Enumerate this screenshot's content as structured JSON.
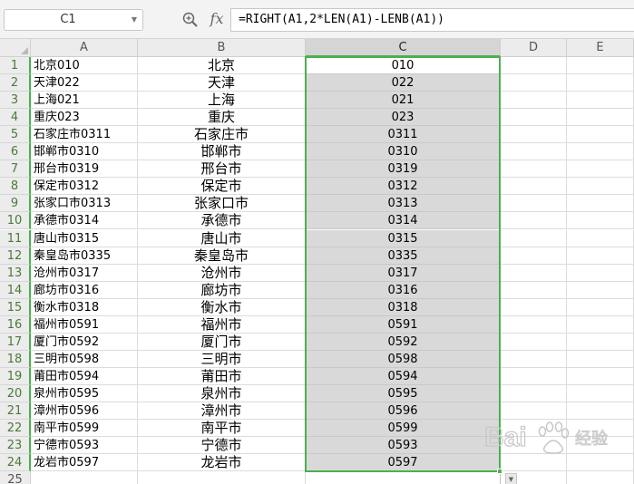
{
  "name_box": {
    "value": "C1"
  },
  "formula_bar": {
    "fx_label": "fx",
    "formula": "=RIGHT(A1,2*LEN(A1)-LENB(A1))"
  },
  "columns": [
    {
      "label": "A",
      "selected": false
    },
    {
      "label": "B",
      "selected": false
    },
    {
      "label": "C",
      "selected": true
    },
    {
      "label": "D",
      "selected": false
    },
    {
      "label": "E",
      "selected": false
    }
  ],
  "rows": [
    {
      "num": "1",
      "a": "北京010",
      "b": "北京",
      "c": "010"
    },
    {
      "num": "2",
      "a": "天津022",
      "b": "天津",
      "c": "022"
    },
    {
      "num": "3",
      "a": "上海021",
      "b": "上海",
      "c": "021"
    },
    {
      "num": "4",
      "a": "重庆023",
      "b": "重庆",
      "c": "023"
    },
    {
      "num": "5",
      "a": "石家庄市0311",
      "b": "石家庄市",
      "c": "0311"
    },
    {
      "num": "6",
      "a": "邯郸市0310",
      "b": "邯郸市",
      "c": "0310"
    },
    {
      "num": "7",
      "a": "邢台市0319",
      "b": "邢台市",
      "c": "0319"
    },
    {
      "num": "8",
      "a": "保定市0312",
      "b": "保定市",
      "c": "0312"
    },
    {
      "num": "9",
      "a": "张家口市0313",
      "b": "张家口市",
      "c": "0313"
    },
    {
      "num": "10",
      "a": "承德市0314",
      "b": "承德市",
      "c": "0314"
    },
    {
      "num": "11",
      "a": "唐山市0315",
      "b": "唐山市",
      "c": "0315"
    },
    {
      "num": "12",
      "a": "秦皇岛市0335",
      "b": "秦皇岛市",
      "c": "0335"
    },
    {
      "num": "13",
      "a": "沧州市0317",
      "b": "沧州市",
      "c": "0317"
    },
    {
      "num": "14",
      "a": "廊坊市0316",
      "b": "廊坊市",
      "c": "0316"
    },
    {
      "num": "15",
      "a": "衡水市0318",
      "b": "衡水市",
      "c": "0318"
    },
    {
      "num": "16",
      "a": "福州市0591",
      "b": "福州市",
      "c": "0591"
    },
    {
      "num": "17",
      "a": "厦门市0592",
      "b": "厦门市",
      "c": "0592"
    },
    {
      "num": "18",
      "a": "三明市0598",
      "b": "三明市",
      "c": "0598"
    },
    {
      "num": "19",
      "a": "莆田市0594",
      "b": "莆田市",
      "c": "0594"
    },
    {
      "num": "20",
      "a": "泉州市0595",
      "b": "泉州市",
      "c": "0595"
    },
    {
      "num": "21",
      "a": "漳州市0596",
      "b": "漳州市",
      "c": "0596"
    },
    {
      "num": "22",
      "a": "南平市0599",
      "b": "南平市",
      "c": "0599"
    },
    {
      "num": "23",
      "a": "宁德市0593",
      "b": "宁德市",
      "c": "0593"
    },
    {
      "num": "24",
      "a": "龙岩市0597",
      "b": "龙岩市",
      "c": "0597"
    },
    {
      "num": "25",
      "a": "",
      "b": "",
      "c": ""
    }
  ],
  "watermark": {
    "text": "Bai",
    "text2": "经验"
  },
  "colors": {
    "selection": "#4caf50",
    "selected_fill": "#d9d9d9"
  }
}
